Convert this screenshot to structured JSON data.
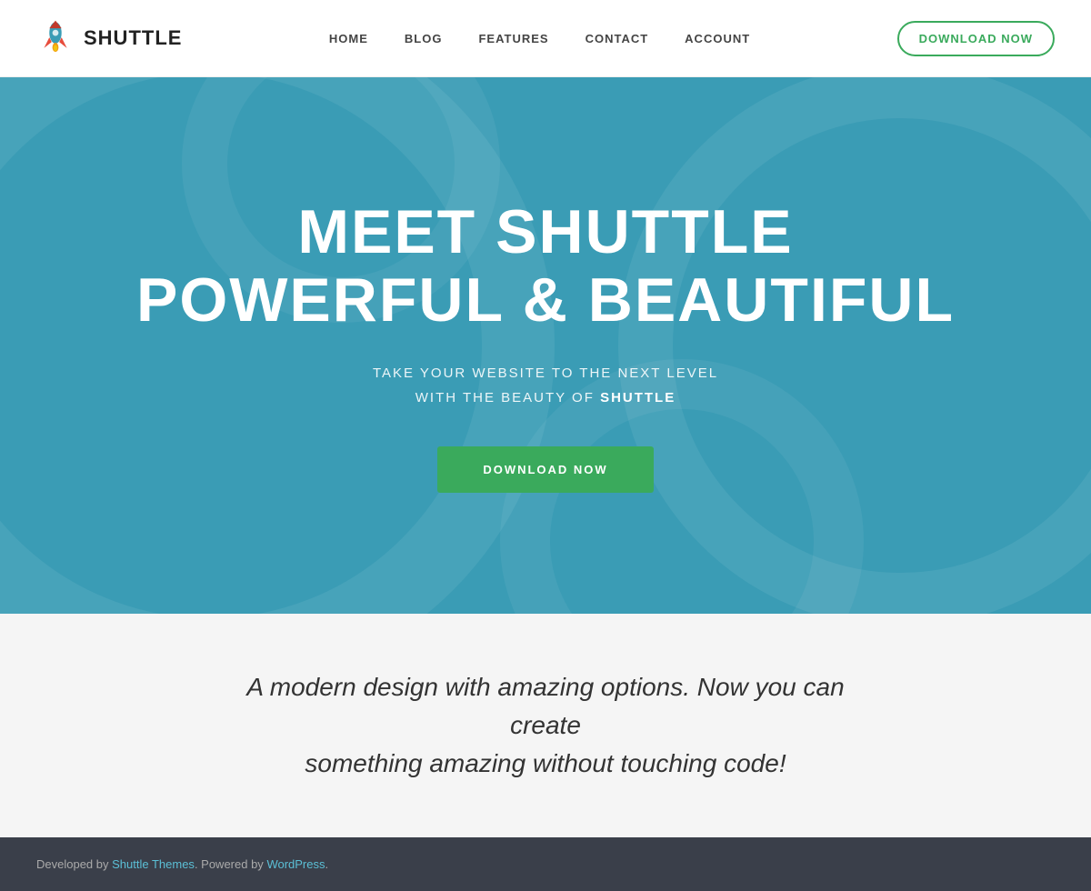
{
  "header": {
    "logo_text": "SHUTTLE",
    "nav_items": [
      {
        "label": "HOME",
        "id": "home"
      },
      {
        "label": "BLOG",
        "id": "blog"
      },
      {
        "label": "FEATURES",
        "id": "features"
      },
      {
        "label": "CONTACT",
        "id": "contact"
      },
      {
        "label": "ACCOUNT",
        "id": "account"
      }
    ],
    "download_btn": "DOWNLOAD NOW"
  },
  "hero": {
    "title_line1": "MEET SHUTTLE",
    "title_line2": "POWERFUL & BEAUTIFUL",
    "subtitle_line1": "TAKE YOUR WEBSITE TO THE NEXT LEVEL",
    "subtitle_line2_plain": "WITH THE BEAUTY OF ",
    "subtitle_line2_bold": "SHUTTLE",
    "download_btn": "DOWNLOAD NOW"
  },
  "tagline": {
    "text_plain": "A modern design with amazing options. Now you can create",
    "text_plain2": "something amazing without touching code!"
  },
  "footer": {
    "prefix": "Developed by ",
    "link1_label": "Shuttle Themes",
    "link1_href": "#",
    "middle": ". Powered by ",
    "link2_label": "WordPress",
    "link2_href": "#",
    "suffix": "."
  }
}
